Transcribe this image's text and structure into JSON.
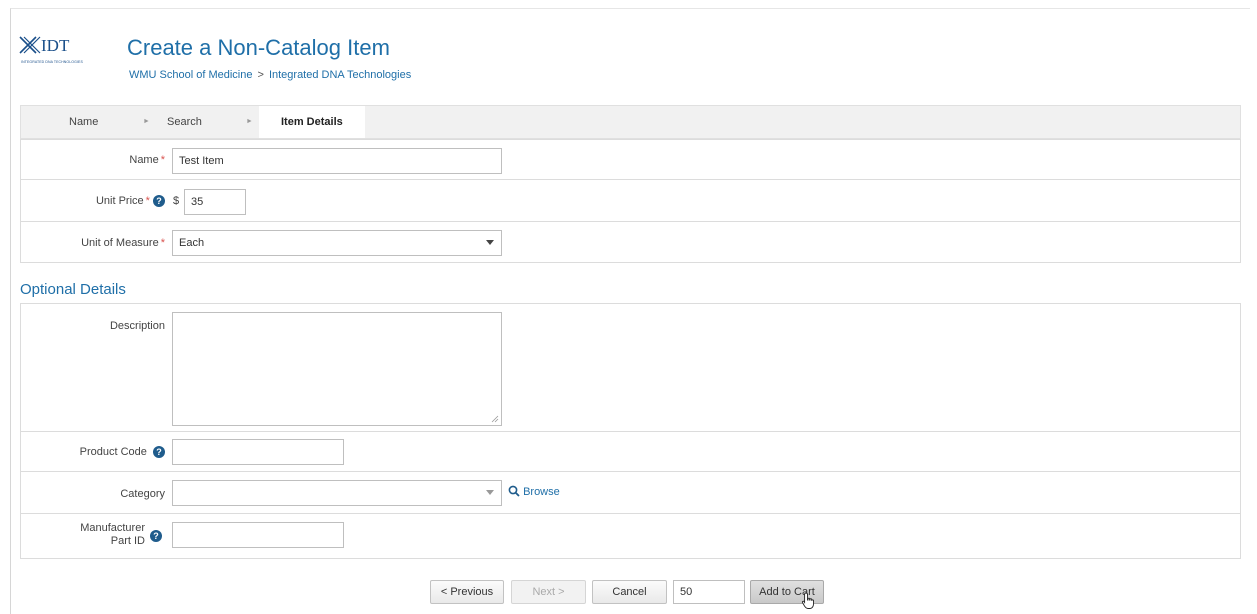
{
  "header": {
    "logo_text": "IDT",
    "logo_tagline": "INTEGRATED DNA TECHNOLOGIES",
    "title": "Create a Non-Catalog Item",
    "breadcrumb": [
      "WMU School of Medicine",
      "Integrated DNA Technologies"
    ],
    "breadcrumb_separator": ">"
  },
  "steps": [
    {
      "label": "Name",
      "active": false
    },
    {
      "label": "Search",
      "active": false
    },
    {
      "label": "Item Details",
      "active": true
    }
  ],
  "form": {
    "name": {
      "label": "Name",
      "value": "Test Item"
    },
    "unit_price": {
      "label": "Unit Price",
      "currency": "$",
      "value": "35"
    },
    "unit_of_measure": {
      "label": "Unit of Measure",
      "value": "Each"
    }
  },
  "optional": {
    "section_title": "Optional Details",
    "description": {
      "label": "Description",
      "value": ""
    },
    "product_code": {
      "label": "Product Code",
      "value": ""
    },
    "category": {
      "label": "Category",
      "value": "",
      "browse_label": "Browse"
    },
    "manufacturer_part_id": {
      "label_line1": "Manufacturer",
      "label_line2": "Part ID",
      "value": ""
    }
  },
  "footer": {
    "previous_label": "< Previous",
    "next_label": "Next >",
    "cancel_label": "Cancel",
    "quantity_value": "50",
    "add_to_cart_label": "Add to Cart"
  },
  "colors": {
    "accent": "#1f6fa8",
    "required": "#d9534f",
    "help_icon": "#1f5c8c"
  }
}
